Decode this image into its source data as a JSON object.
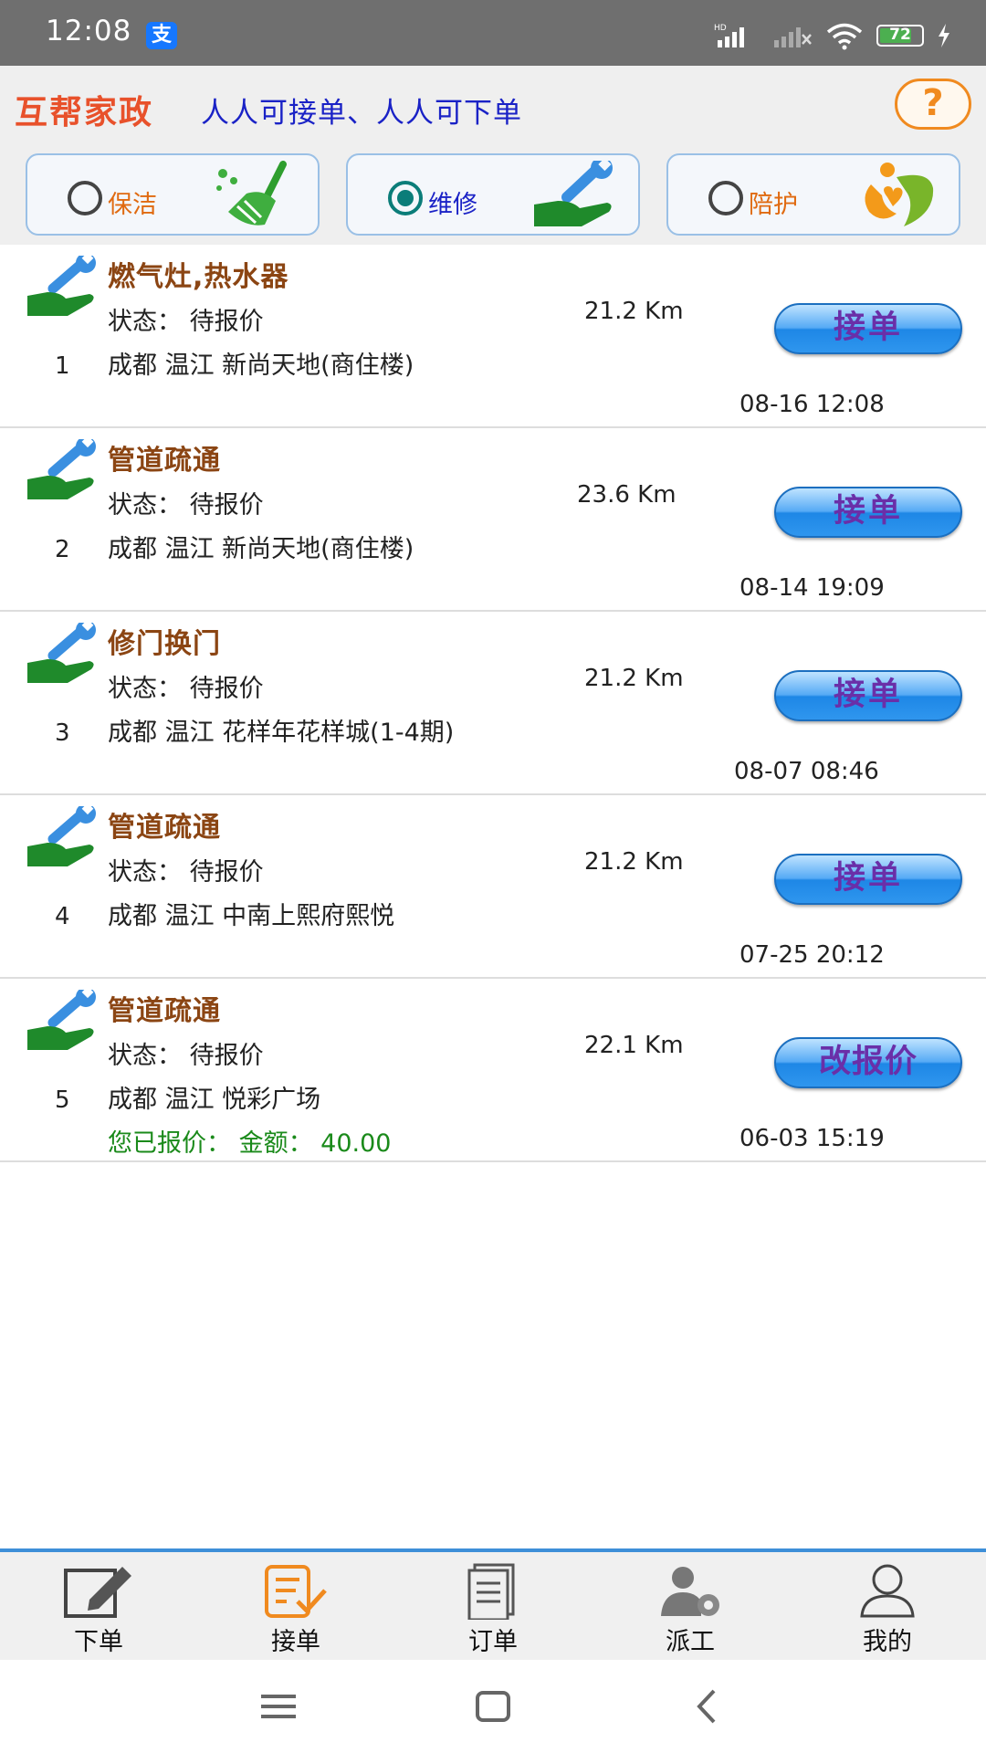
{
  "status_bar": {
    "time": "12:08",
    "pay_badge": "支",
    "battery": "72"
  },
  "header": {
    "brand": "互帮家政",
    "slogan": "人人可接单、人人可下单",
    "help_label": "?"
  },
  "categories": [
    {
      "label": "保洁",
      "selected": false,
      "color": "#e06a10"
    },
    {
      "label": "维修",
      "selected": true,
      "color": "#1a22c6"
    },
    {
      "label": "陪护",
      "selected": false,
      "color": "#e06a10"
    }
  ],
  "orders": [
    {
      "index": "1",
      "title": "燃气灶,热水器",
      "status": "状态： 待报价",
      "address": "成都 温江 新尚天地(商住楼)",
      "distance": "21.2 Km",
      "time": "08-16 12:08",
      "button": "接单",
      "quote": ""
    },
    {
      "index": "2",
      "title": "管道疏通",
      "status": "状态： 待报价",
      "address": "成都 温江 新尚天地(商住楼)",
      "distance": "23.6 Km",
      "time": "08-14 19:09",
      "button": "接单",
      "quote": ""
    },
    {
      "index": "3",
      "title": "修门换门",
      "status": "状态： 待报价",
      "address": "成都 温江 花样年花样城(1-4期)",
      "distance": "21.2 Km",
      "time": "08-07 08:46",
      "button": "接单",
      "quote": ""
    },
    {
      "index": "4",
      "title": "管道疏通",
      "status": "状态： 待报价",
      "address": "成都 温江 中南上熙府熙悦",
      "distance": "21.2 Km",
      "time": "07-25 20:12",
      "button": "接单",
      "quote": ""
    },
    {
      "index": "5",
      "title": "管道疏通",
      "status": "状态： 待报价",
      "address": "成都 温江 悦彩广场",
      "distance": "22.1 Km",
      "time": "06-03 15:19",
      "button": "改报价",
      "quote": "您已报价： 金额： 40.00"
    }
  ],
  "bottom_nav": [
    {
      "label": "下单",
      "icon": "edit-icon"
    },
    {
      "label": "接单",
      "icon": "accept-order-icon",
      "active": true
    },
    {
      "label": "订单",
      "icon": "document-icon"
    },
    {
      "label": "派工",
      "icon": "worker-gear-icon"
    },
    {
      "label": "我的",
      "icon": "user-icon"
    }
  ],
  "colors": {
    "brand": "#e8512b",
    "slogan": "#1a22c6",
    "title": "#8b4513",
    "quote": "#1a8a1a",
    "nav_active": "#f08a1f",
    "nav_accent": "#3e8fd8"
  }
}
